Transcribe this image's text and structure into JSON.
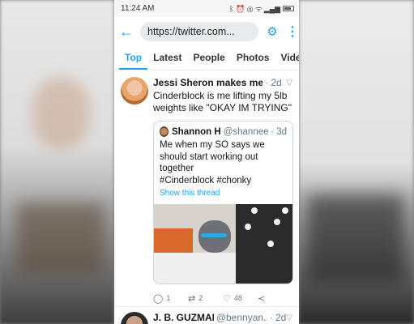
{
  "status": {
    "time": "11:24 AM",
    "icons": "ᛒ ⏰ ◎ ᯤ ▂▄▆"
  },
  "browser": {
    "url": "https://twitter.com..."
  },
  "tabs": [
    "Top",
    "Latest",
    "People",
    "Photos",
    "Videos"
  ],
  "tweet1": {
    "name": "Jessi Sheron makes mer...",
    "time": "· 2d",
    "text": "Cinderblock is me lifting my 5lb weights like \"OKAY IM TRYING\"",
    "quote": {
      "name": "Shannon H",
      "handle": "@shannee...",
      "time": "· 3d",
      "text_lines": [
        "Me when my SO says we",
        "should start working out",
        "together",
        "#Cinderblock #chonky"
      ],
      "show_thread": "Show this thread"
    },
    "actions": {
      "replies": "1",
      "retweets": "2",
      "likes": "48"
    }
  },
  "tweet2": {
    "name": "J. B. GUZMAN",
    "handle": "@bennyan...",
    "time": "· 2d"
  },
  "icons": {
    "back": "back-arrow-icon",
    "filter": "sliders-icon",
    "menu": "more-vertical-icon"
  },
  "colors": {
    "accent": "#1da1f2",
    "text": "#14171a",
    "muted": "#657786"
  }
}
